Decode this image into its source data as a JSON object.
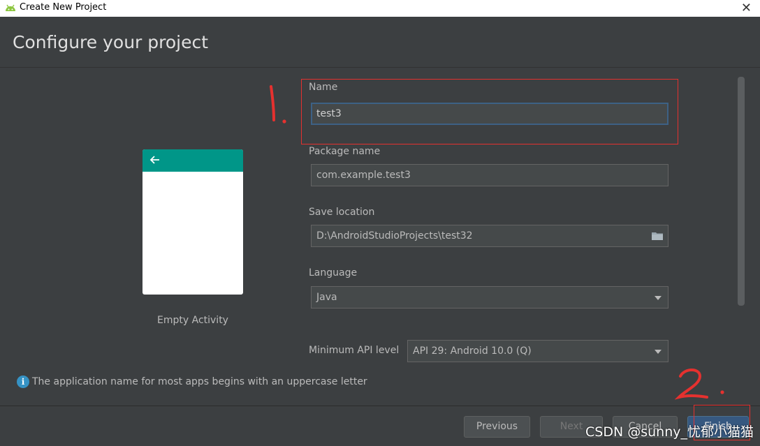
{
  "window": {
    "title": "Create New Project",
    "close_glyph": "✕",
    "icon": "android-icon"
  },
  "page": {
    "heading": "Configure your project"
  },
  "preview": {
    "template_name": "Empty Activity",
    "appbar_color": "#009688"
  },
  "form": {
    "name": {
      "label": "Name",
      "value": "test3"
    },
    "package": {
      "label": "Package name",
      "value": "com.example.test3"
    },
    "save_location": {
      "label": "Save location",
      "value": "D:\\AndroidStudioProjects\\test32"
    },
    "language": {
      "label": "Language",
      "value": "Java"
    },
    "min_api": {
      "label": "Minimum API level",
      "value": "API 29: Android 10.0 (Q)"
    }
  },
  "info": {
    "icon": "info-icon",
    "message": "The application name for most apps begins with an uppercase letter"
  },
  "buttons": {
    "previous": "Previous",
    "next": "Next",
    "cancel": "Cancel",
    "finish": "Finish"
  },
  "annotations": {
    "mark1": "1.",
    "mark2": "2.",
    "color": "#e5312f"
  },
  "watermark": "CSDN @sunny_忧郁小猫猫"
}
